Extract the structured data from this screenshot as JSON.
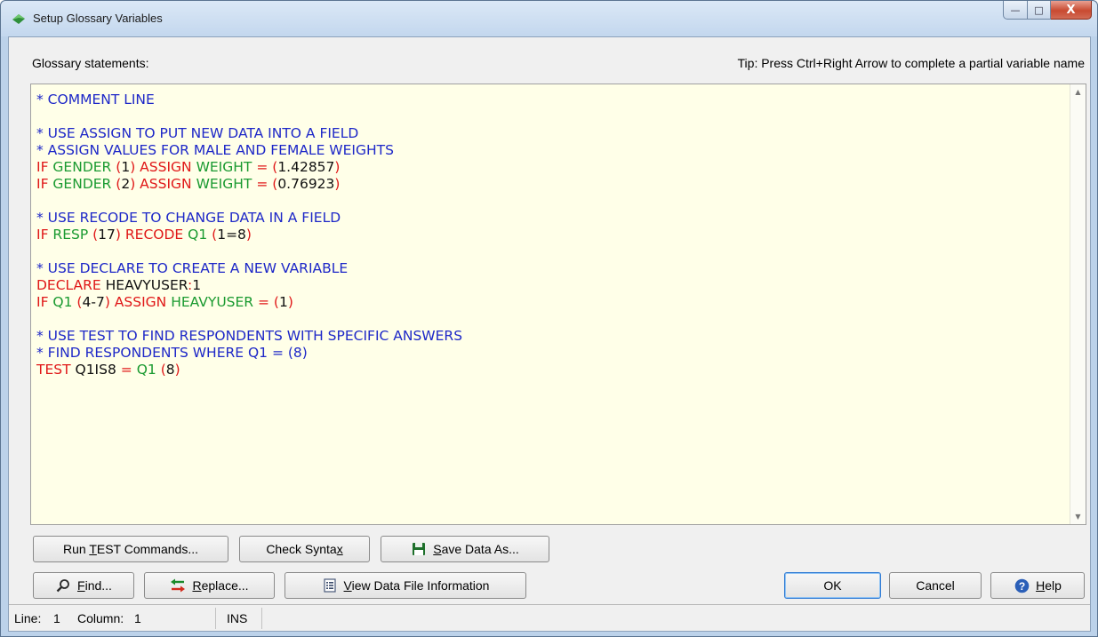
{
  "window": {
    "title": "Setup Glossary Variables",
    "controls": {
      "minimize": "—",
      "maximize": "□",
      "close": "X"
    }
  },
  "labels": {
    "glossary_statements": "Glossary statements:",
    "tip": "Tip: Press Ctrl+Right Arrow to complete a partial variable name"
  },
  "colors": {
    "comment": "#1e28c8",
    "keyword": "#e01818",
    "variable": "#1a9a30",
    "plain": "#111111",
    "editor_bg": "#ffffe8"
  },
  "editor": {
    "lines": [
      [
        {
          "t": "* COMMENT LINE",
          "c": "blue"
        }
      ],
      [],
      [
        {
          "t": "* USE ASSIGN TO PUT NEW DATA INTO A FIELD",
          "c": "blue"
        }
      ],
      [
        {
          "t": "* ASSIGN VALUES FOR MALE AND FEMALE WEIGHTS",
          "c": "blue"
        }
      ],
      [
        {
          "t": "IF ",
          "c": "red"
        },
        {
          "t": "GENDER ",
          "c": "green"
        },
        {
          "t": "(",
          "c": "red"
        },
        {
          "t": "1",
          "c": "dark"
        },
        {
          "t": ") ",
          "c": "red"
        },
        {
          "t": "ASSIGN ",
          "c": "red"
        },
        {
          "t": "WEIGHT ",
          "c": "green"
        },
        {
          "t": "= ",
          "c": "red"
        },
        {
          "t": "(",
          "c": "red"
        },
        {
          "t": "1.42857",
          "c": "dark"
        },
        {
          "t": ")",
          "c": "red"
        }
      ],
      [
        {
          "t": "IF ",
          "c": "red"
        },
        {
          "t": "GENDER ",
          "c": "green"
        },
        {
          "t": "(",
          "c": "red"
        },
        {
          "t": "2",
          "c": "dark"
        },
        {
          "t": ") ",
          "c": "red"
        },
        {
          "t": "ASSIGN ",
          "c": "red"
        },
        {
          "t": "WEIGHT ",
          "c": "green"
        },
        {
          "t": "= ",
          "c": "red"
        },
        {
          "t": "(",
          "c": "red"
        },
        {
          "t": "0.76923",
          "c": "dark"
        },
        {
          "t": ")",
          "c": "red"
        }
      ],
      [],
      [
        {
          "t": "* USE RECODE TO CHANGE DATA IN A FIELD",
          "c": "blue"
        }
      ],
      [
        {
          "t": "IF ",
          "c": "red"
        },
        {
          "t": "RESP ",
          "c": "green"
        },
        {
          "t": "(",
          "c": "red"
        },
        {
          "t": "17",
          "c": "dark"
        },
        {
          "t": ") ",
          "c": "red"
        },
        {
          "t": "RECODE ",
          "c": "red"
        },
        {
          "t": "Q1 ",
          "c": "green"
        },
        {
          "t": "(",
          "c": "red"
        },
        {
          "t": "1=8",
          "c": "dark"
        },
        {
          "t": ")",
          "c": "red"
        }
      ],
      [],
      [
        {
          "t": "* USE DECLARE TO CREATE A NEW VARIABLE",
          "c": "blue"
        }
      ],
      [
        {
          "t": "DECLARE ",
          "c": "red"
        },
        {
          "t": "HEAVYUSER",
          "c": "dark"
        },
        {
          "t": ":",
          "c": "red"
        },
        {
          "t": "1",
          "c": "dark"
        }
      ],
      [
        {
          "t": "IF ",
          "c": "red"
        },
        {
          "t": "Q1 ",
          "c": "green"
        },
        {
          "t": "(",
          "c": "red"
        },
        {
          "t": "4-7",
          "c": "dark"
        },
        {
          "t": ") ",
          "c": "red"
        },
        {
          "t": "ASSIGN ",
          "c": "red"
        },
        {
          "t": "HEAVYUSER ",
          "c": "green"
        },
        {
          "t": "= ",
          "c": "red"
        },
        {
          "t": "(",
          "c": "red"
        },
        {
          "t": "1",
          "c": "dark"
        },
        {
          "t": ")",
          "c": "red"
        }
      ],
      [],
      [
        {
          "t": "* USE TEST TO FIND RESPONDENTS WITH SPECIFIC ANSWERS",
          "c": "blue"
        }
      ],
      [
        {
          "t": "* FIND RESPONDENTS WHERE Q1 = (8)",
          "c": "blue"
        }
      ],
      [
        {
          "t": "TEST ",
          "c": "red"
        },
        {
          "t": "Q1IS8 ",
          "c": "dark"
        },
        {
          "t": "= ",
          "c": "red"
        },
        {
          "t": "Q1 ",
          "c": "green"
        },
        {
          "t": "(",
          "c": "red"
        },
        {
          "t": "8",
          "c": "dark"
        },
        {
          "t": ")",
          "c": "red"
        }
      ]
    ]
  },
  "buttons": {
    "run_test": {
      "pre": "Run ",
      "key": "T",
      "post": "EST Commands..."
    },
    "check_syntax": {
      "pre": "Check Synta",
      "key": "x",
      "post": ""
    },
    "save_data_as": {
      "pre": "",
      "key": "S",
      "post": "ave Data As..."
    },
    "find": {
      "pre": "",
      "key": "F",
      "post": "ind..."
    },
    "replace": {
      "pre": "",
      "key": "R",
      "post": "eplace..."
    },
    "view_info": {
      "pre": "",
      "key": "V",
      "post": "iew Data File Information"
    },
    "ok": "OK",
    "cancel": "Cancel",
    "help": {
      "pre": "",
      "key": "H",
      "post": "elp"
    }
  },
  "statusbar": {
    "line_label": "Line:",
    "line_value": "1",
    "column_label": "Column:",
    "column_value": "1",
    "mode": "INS"
  }
}
